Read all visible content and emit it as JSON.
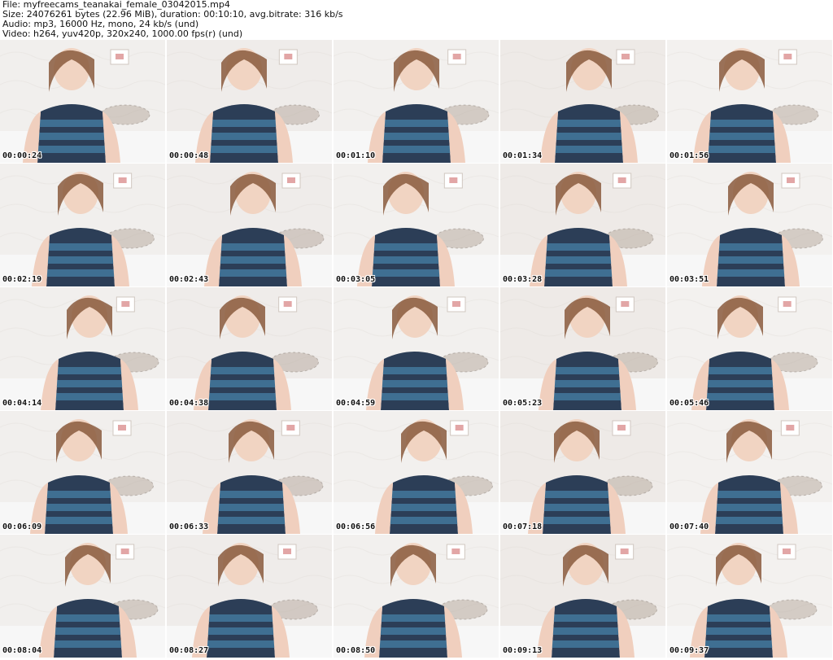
{
  "header": {
    "file_line": "File: myfreecams_teanakai_female_03042015.mp4",
    "size_line": "Size: 24076261 bytes (22.96 MiB), duration: 00:10:10, avg.bitrate: 316 kb/s",
    "audio_line": "Audio: mp3, 16000 Hz, mono, 24 kb/s (und)",
    "video_line": "Video: h264, yuv420p, 320x240, 1000.00 fps(r) (und)"
  },
  "thumbnails": [
    {
      "timestamp": "00:00:24"
    },
    {
      "timestamp": "00:00:48"
    },
    {
      "timestamp": "00:01:10"
    },
    {
      "timestamp": "00:01:34"
    },
    {
      "timestamp": "00:01:56"
    },
    {
      "timestamp": "00:02:19"
    },
    {
      "timestamp": "00:02:43"
    },
    {
      "timestamp": "00:03:05"
    },
    {
      "timestamp": "00:03:28"
    },
    {
      "timestamp": "00:03:51"
    },
    {
      "timestamp": "00:04:14"
    },
    {
      "timestamp": "00:04:38"
    },
    {
      "timestamp": "00:04:59"
    },
    {
      "timestamp": "00:05:23"
    },
    {
      "timestamp": "00:05:46"
    },
    {
      "timestamp": "00:06:09"
    },
    {
      "timestamp": "00:06:33"
    },
    {
      "timestamp": "00:06:56"
    },
    {
      "timestamp": "00:07:18"
    },
    {
      "timestamp": "00:07:40"
    },
    {
      "timestamp": "00:08:04"
    },
    {
      "timestamp": "00:08:27"
    },
    {
      "timestamp": "00:08:50"
    },
    {
      "timestamp": "00:09:13"
    },
    {
      "timestamp": "00:09:37"
    }
  ]
}
